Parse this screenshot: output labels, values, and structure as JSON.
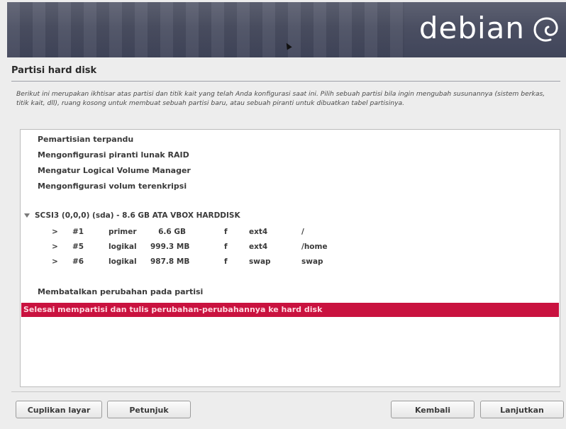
{
  "header": {
    "brand": "debian"
  },
  "page": {
    "title": "Partisi hard disk",
    "instruction": "Berikut ini merupakan ikhtisar atas partisi dan titik kait yang telah Anda konfigurasi saat ini. Pilih sebuah partisi bila ingin mengubah susunannya (sistem berkas, titik kait, dll), ruang kosong untuk membuat sebuah partisi baru, atau sebuah piranti untuk dibuatkan tabel partisinya."
  },
  "menu": {
    "items": [
      {
        "label": "Pemartisian terpandu"
      },
      {
        "label": "Mengonfigurasi piranti lunak RAID"
      },
      {
        "label": "Mengatur Logical Volume Manager"
      },
      {
        "label": "Mengonfigurasi volum terenkripsi"
      }
    ]
  },
  "disk": {
    "label": "SCSI3 (0,0,0) (sda) - 8.6 GB ATA VBOX HARDDISK",
    "partitions": [
      {
        "arrow": ">",
        "number": "#1",
        "type": "primer",
        "size": "6.6 GB",
        "flag": "f",
        "fs": "ext4",
        "mount": "/"
      },
      {
        "arrow": ">",
        "number": "#5",
        "type": "logikal",
        "size": "999.3 MB",
        "flag": "f",
        "fs": "ext4",
        "mount": "/home"
      },
      {
        "arrow": ">",
        "number": "#6",
        "type": "logikal",
        "size": "987.8 MB",
        "flag": "f",
        "fs": "swap",
        "mount": "swap"
      }
    ]
  },
  "actions": {
    "undo": "Membatalkan perubahan pada partisi",
    "finish": "Selesai mempartisi dan tulis perubahan-perubahannya ke hard disk"
  },
  "footer": {
    "screenshot": "Cuplikan layar",
    "help": "Petunjuk",
    "back": "Kembali",
    "continue": "Lanjutkan"
  },
  "colors": {
    "selection": "#c9123f",
    "banner": "#4b4f62"
  }
}
